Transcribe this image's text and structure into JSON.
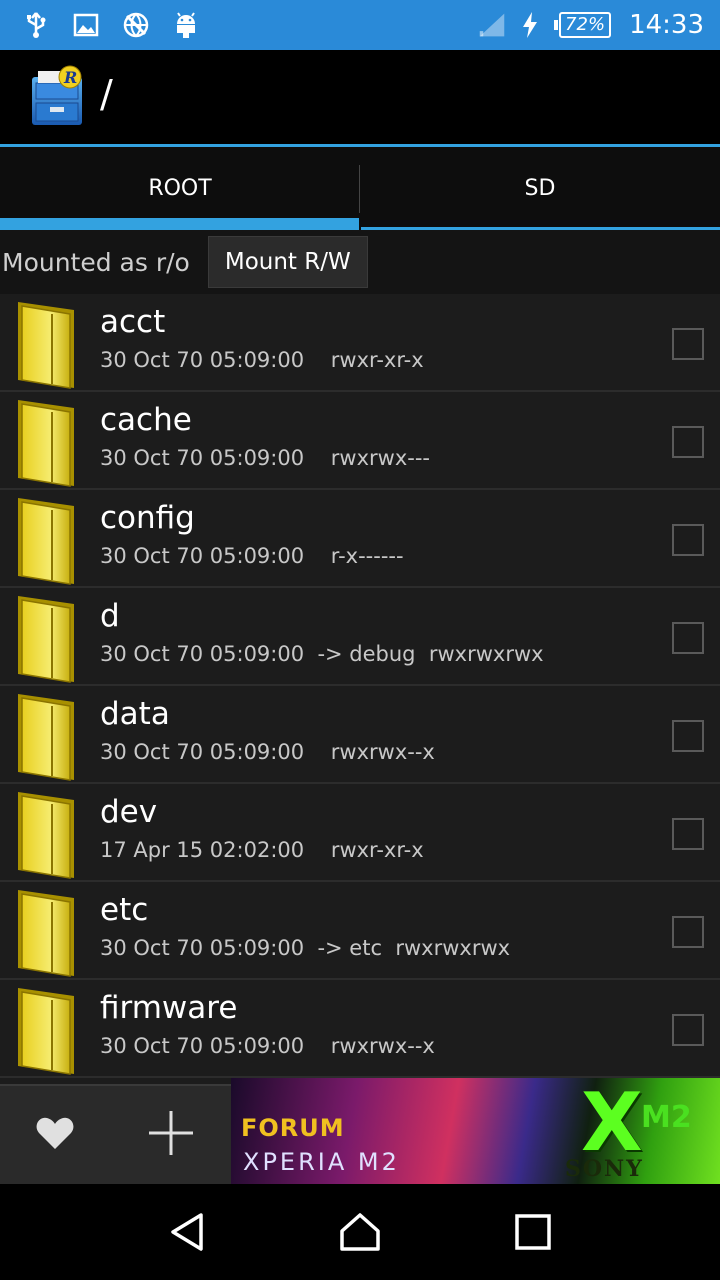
{
  "status_bar": {
    "icons_left": [
      "usb-icon",
      "image-icon",
      "no-network-icon",
      "android-icon"
    ],
    "battery": "72%",
    "time": "14:33"
  },
  "action_bar": {
    "app_icon": "root-explorer-icon",
    "path": "/"
  },
  "tabs": [
    {
      "label": "ROOT",
      "active": true
    },
    {
      "label": "SD",
      "active": false
    }
  ],
  "mount": {
    "status": "Mounted as r/o",
    "button_label": "Mount R/W"
  },
  "files": [
    {
      "name": "acct",
      "meta": "30 Oct 70 05:09:00    rwxr-xr-x"
    },
    {
      "name": "cache",
      "meta": "30 Oct 70 05:09:00    rwxrwx---"
    },
    {
      "name": "config",
      "meta": "30 Oct 70 05:09:00    r-x------"
    },
    {
      "name": "d",
      "meta": "30 Oct 70 05:09:00  -> debug  rwxrwxrwx"
    },
    {
      "name": "data",
      "meta": "30 Oct 70 05:09:00    rwxrwx--x"
    },
    {
      "name": "dev",
      "meta": "17 Apr 15 02:02:00    rwxr-xr-x"
    },
    {
      "name": "etc",
      "meta": "30 Oct 70 05:09:00  -> etc  rwxrwxrwx"
    },
    {
      "name": "firmware",
      "meta": "30 Oct 70 05:09:00    rwxrwx--x"
    }
  ],
  "bottom_bar": {
    "favorite_icon": "heart-icon",
    "add_icon": "plus-icon"
  },
  "banner": {
    "forum": "FORUM",
    "xperia": "XPERIA M2",
    "x": "X",
    "m2": "M2",
    "sony": "SONY"
  },
  "nav_bar": [
    "back-icon",
    "home-icon",
    "recents-icon"
  ]
}
